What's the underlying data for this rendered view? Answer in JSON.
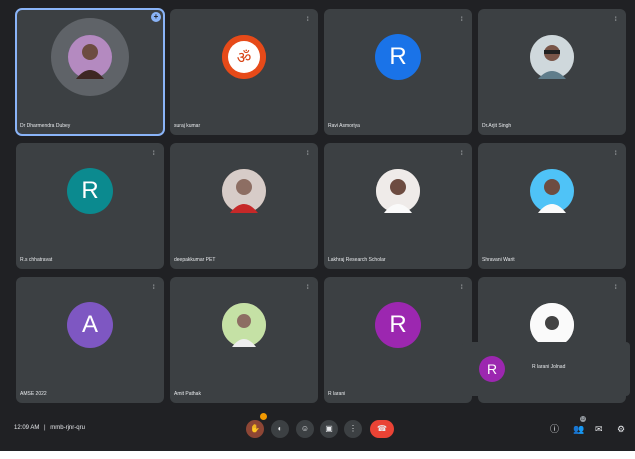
{
  "tiles": [
    {
      "name": "Dr Dharmendra Dubey",
      "avatar_type": "photo",
      "color": "#6a4c93",
      "active": true
    },
    {
      "name": "suraj kumar",
      "avatar_type": "photo",
      "color": "#d84315"
    },
    {
      "name": "Ravi Asmoriya",
      "avatar_type": "letter",
      "letter": "R",
      "color": "#1a73e8"
    },
    {
      "name": "Dr.Arjit Singh",
      "avatar_type": "photo",
      "color": "#9e9e9e"
    },
    {
      "name": "R.s chhatravat",
      "avatar_type": "letter",
      "letter": "R",
      "color": "#0b8a8f"
    },
    {
      "name": "deepakkumar PET",
      "avatar_type": "photo",
      "color": "#8d6e63"
    },
    {
      "name": "Lakhraj Research Scholar",
      "avatar_type": "photo",
      "color": "#d7ccc8"
    },
    {
      "name": "Shravani Warit",
      "avatar_type": "photo",
      "color": "#4e6b7a"
    },
    {
      "name": "AMSE 2022",
      "avatar_type": "letter",
      "letter": "A",
      "color": "#7e57c2"
    },
    {
      "name": "Amit Pathak",
      "avatar_type": "photo",
      "color": "#bcaaa4"
    },
    {
      "name": "R larani",
      "avatar_type": "letter",
      "letter": "R",
      "color": "#9c27b0"
    },
    {
      "name": "",
      "avatar_type": "photo",
      "color": "#eeeeee"
    }
  ],
  "self_view": {
    "name": "R larani Jolnad",
    "letter": "R",
    "color": "#9c27b0"
  },
  "bottom_bar": {
    "time": "12:09 AM",
    "separator": "|",
    "meeting_code": "mmb-rjnr-qru",
    "participants_badge": "12"
  },
  "colors": {
    "background": "#202124",
    "tile": "#3c4043",
    "accent": "#8ab4f8",
    "hangup": "#ea4335"
  }
}
